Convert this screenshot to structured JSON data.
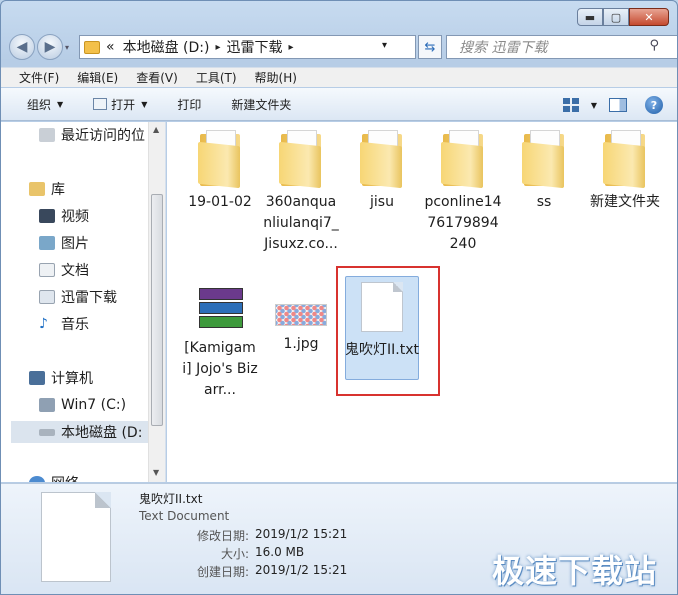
{
  "window": {
    "minimize": "▬",
    "maximize": "▢",
    "close": "✕"
  },
  "address": {
    "prefix": "«",
    "segments": [
      "本地磁盘 (D:)",
      "迅雷下载"
    ],
    "sep": "▸",
    "dropdown": "▾"
  },
  "search": {
    "placeholder": "搜索 迅雷下载",
    "icon": "search-icon"
  },
  "menu": [
    "文件(F)",
    "编辑(E)",
    "查看(V)",
    "工具(T)",
    "帮助(H)"
  ],
  "toolbar": {
    "organize": "组织",
    "open": "打开",
    "print": "打印",
    "new_folder": "新建文件夹",
    "help": "?"
  },
  "nav": {
    "recent": "最近访问的位",
    "library": "库",
    "videos": "视频",
    "pictures": "图片",
    "documents": "文档",
    "thunder": "迅雷下载",
    "music": "音乐",
    "computer": "计算机",
    "win7": "Win7 (C:)",
    "local_d": "本地磁盘 (D:",
    "network": "网络"
  },
  "files": [
    {
      "name": "19-01-02",
      "type": "folder"
    },
    {
      "name": "360anquanliulanqi7_Jisuxz.co...",
      "type": "folder"
    },
    {
      "name": "jisu",
      "type": "folder"
    },
    {
      "name": "pconline1476179894240",
      "type": "folder"
    },
    {
      "name": "ss",
      "type": "folder"
    },
    {
      "name": "新建文件夹",
      "type": "folder"
    },
    {
      "name": "[Kamigami] Jojo's Bizarr...",
      "type": "rar"
    },
    {
      "name": "1.jpg",
      "type": "image"
    },
    {
      "name": "鬼吹灯II.txt",
      "type": "text",
      "selected": true
    }
  ],
  "details": {
    "name": "鬼吹灯II.txt",
    "type": "Text Document",
    "modified_label": "修改日期:",
    "modified": "2019/1/2 15:21",
    "size_label": "大小:",
    "size": "16.0 MB",
    "created_label": "创建日期:",
    "created": "2019/1/2 15:21"
  },
  "watermark": "极速下载站"
}
